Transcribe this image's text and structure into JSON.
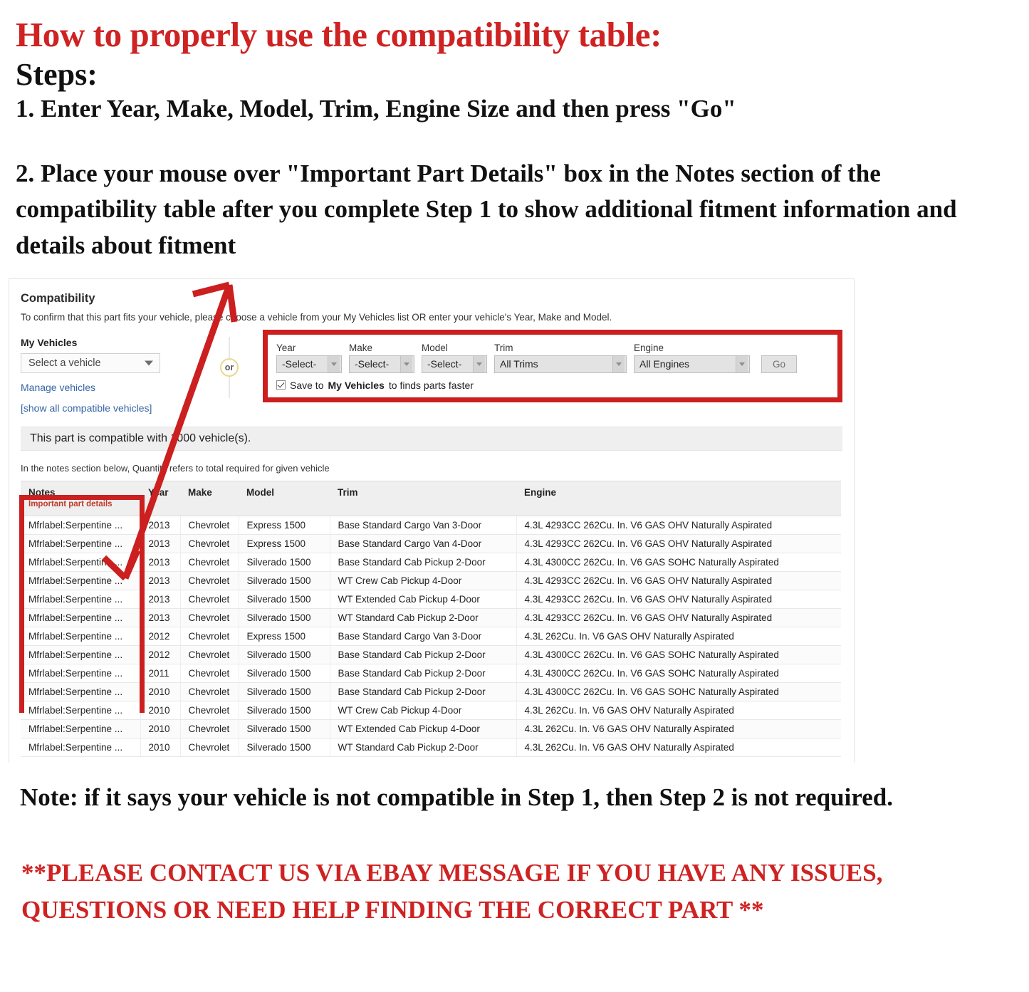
{
  "headline": "How to properly use the compatibility table:",
  "steps_label": "Steps:",
  "step_one": "1. Enter Year, Make, Model, Trim, Engine Size and then press \"Go\"",
  "step_two": "2. Place your mouse over \"Important Part Details\" box in the Notes section of the compatibility table after you complete Step 1 to show additional fitment information and details about fitment",
  "note_text": "Note: if it says your vehicle is not compatible in Step 1, then Step 2 is not required.",
  "contact_text": "**PLEASE CONTACT US VIA EBAY MESSAGE IF YOU HAVE ANY ISSUES, QUESTIONS OR NEED HELP FINDING THE CORRECT PART **",
  "colors": {
    "accent_red": "#cf2222",
    "box_red": "#cc1f1f",
    "link_blue": "#3665a5",
    "notes_sub_red": "#c0392b",
    "or_ring": "#e8d98a"
  },
  "panel": {
    "title": "Compatibility",
    "subtitle": "To confirm that this part fits your vehicle, please choose a vehicle from your My Vehicles list OR enter your vehicle's Year, Make and Model.",
    "my_vehicles_label": "My Vehicles",
    "select_vehicle_value": "Select a vehicle",
    "manage_vehicles_link": "Manage vehicles",
    "or_label": "or",
    "show_all_link": "[show all compatible vehicles]",
    "compat_count_text": "This part is compatible with 1000 vehicle(s).",
    "qty_note": "In the notes section below, Quantity refers to total required for given vehicle",
    "finder": {
      "year_label": "Year",
      "year_value": "-Select-",
      "make_label": "Make",
      "make_value": "-Select-",
      "model_label": "Model",
      "model_value": "-Select-",
      "trim_label": "Trim",
      "trim_value": "All Trims",
      "engine_label": "Engine",
      "engine_value": "All Engines",
      "go_label": "Go",
      "save_prefix": "Save to ",
      "save_bold": "My Vehicles",
      "save_suffix": " to finds parts faster",
      "save_checked": true
    }
  },
  "table": {
    "headers": {
      "notes": "Notes",
      "notes_sub": "Important part details",
      "year": "Year",
      "make": "Make",
      "model": "Model",
      "trim": "Trim",
      "engine": "Engine"
    },
    "rows": [
      {
        "notes": "Mfrlabel:Serpentine ...",
        "year": "2013",
        "make": "Chevrolet",
        "model": "Express 1500",
        "trim": "Base Standard Cargo Van 3-Door",
        "engine": "4.3L 4293CC 262Cu. In. V6 GAS OHV Naturally Aspirated"
      },
      {
        "notes": "Mfrlabel:Serpentine ...",
        "year": "2013",
        "make": "Chevrolet",
        "model": "Express 1500",
        "trim": "Base Standard Cargo Van 4-Door",
        "engine": "4.3L 4293CC 262Cu. In. V6 GAS OHV Naturally Aspirated"
      },
      {
        "notes": "Mfrlabel:Serpentine ...",
        "year": "2013",
        "make": "Chevrolet",
        "model": "Silverado 1500",
        "trim": "Base Standard Cab Pickup 2-Door",
        "engine": "4.3L 4300CC 262Cu. In. V6 GAS SOHC Naturally Aspirated"
      },
      {
        "notes": "Mfrlabel:Serpentine ...",
        "year": "2013",
        "make": "Chevrolet",
        "model": "Silverado 1500",
        "trim": "WT Crew Cab Pickup 4-Door",
        "engine": "4.3L 4293CC 262Cu. In. V6 GAS OHV Naturally Aspirated"
      },
      {
        "notes": "Mfrlabel:Serpentine ...",
        "year": "2013",
        "make": "Chevrolet",
        "model": "Silverado 1500",
        "trim": "WT Extended Cab Pickup 4-Door",
        "engine": "4.3L 4293CC 262Cu. In. V6 GAS OHV Naturally Aspirated"
      },
      {
        "notes": "Mfrlabel:Serpentine ...",
        "year": "2013",
        "make": "Chevrolet",
        "model": "Silverado 1500",
        "trim": "WT Standard Cab Pickup 2-Door",
        "engine": "4.3L 4293CC 262Cu. In. V6 GAS OHV Naturally Aspirated"
      },
      {
        "notes": "Mfrlabel:Serpentine ...",
        "year": "2012",
        "make": "Chevrolet",
        "model": "Express 1500",
        "trim": "Base Standard Cargo Van 3-Door",
        "engine": "4.3L 262Cu. In. V6 GAS OHV Naturally Aspirated"
      },
      {
        "notes": "Mfrlabel:Serpentine ...",
        "year": "2012",
        "make": "Chevrolet",
        "model": "Silverado 1500",
        "trim": "Base Standard Cab Pickup 2-Door",
        "engine": "4.3L 4300CC 262Cu. In. V6 GAS SOHC Naturally Aspirated"
      },
      {
        "notes": "Mfrlabel:Serpentine ...",
        "year": "2011",
        "make": "Chevrolet",
        "model": "Silverado 1500",
        "trim": "Base Standard Cab Pickup 2-Door",
        "engine": "4.3L 4300CC 262Cu. In. V6 GAS SOHC Naturally Aspirated"
      },
      {
        "notes": "Mfrlabel:Serpentine ...",
        "year": "2010",
        "make": "Chevrolet",
        "model": "Silverado 1500",
        "trim": "Base Standard Cab Pickup 2-Door",
        "engine": "4.3L 4300CC 262Cu. In. V6 GAS SOHC Naturally Aspirated"
      },
      {
        "notes": "Mfrlabel:Serpentine ...",
        "year": "2010",
        "make": "Chevrolet",
        "model": "Silverado 1500",
        "trim": "WT Crew Cab Pickup 4-Door",
        "engine": "4.3L 262Cu. In. V6 GAS OHV Naturally Aspirated"
      },
      {
        "notes": "Mfrlabel:Serpentine ...",
        "year": "2010",
        "make": "Chevrolet",
        "model": "Silverado 1500",
        "trim": "WT Extended Cab Pickup 4-Door",
        "engine": "4.3L 262Cu. In. V6 GAS OHV Naturally Aspirated"
      },
      {
        "notes": "Mfrlabel:Serpentine ...",
        "year": "2010",
        "make": "Chevrolet",
        "model": "Silverado 1500",
        "trim": "WT Standard Cab Pickup 2-Door",
        "engine": "4.3L 262Cu. In. V6 GAS OHV Naturally Aspirated"
      }
    ]
  }
}
